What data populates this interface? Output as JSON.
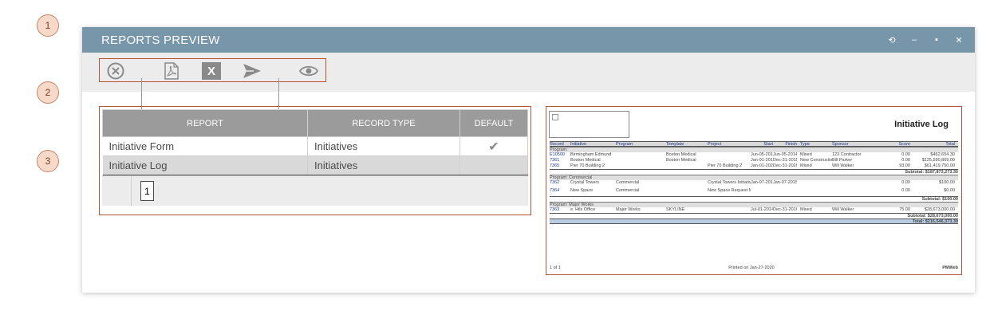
{
  "callouts": [
    "1",
    "2",
    "3"
  ],
  "window": {
    "title": "REPORTS PREVIEW",
    "controls": {
      "refresh": "⟲",
      "minimize": "–",
      "maximize": "▪",
      "close": "✕"
    }
  },
  "toolbar": {
    "icons": [
      "close-circle-icon",
      "pdf-icon",
      "excel-icon",
      "send-icon",
      "eye-icon"
    ],
    "excel_glyph": "X"
  },
  "reports_table": {
    "columns": [
      "REPORT",
      "RECORD TYPE",
      "DEFAULT"
    ],
    "rows": [
      {
        "report": "Initiative Form",
        "record_type": "Initiatives",
        "default": "✔"
      },
      {
        "report": "Initiative Log",
        "record_type": "Initiatives",
        "default": ""
      }
    ],
    "page": "1"
  },
  "preview": {
    "title": "Initiative Log",
    "columns": [
      "Record",
      "Initiative",
      "Program",
      "Template",
      "Project",
      "Start",
      "Finish",
      "Type",
      "Sponsor",
      "Score",
      "Total"
    ],
    "groups": [
      {
        "label": "Program:",
        "rows": [
          [
            "E10500",
            "Birmingham Edmund",
            "",
            "Boston Medical",
            "",
            "Jun-05-2014",
            "Jun-05-2014",
            "Mixed",
            "123 Contractor",
            "0.00",
            "$462,654.30"
          ],
          [
            "7361",
            "Boston Medical",
            "",
            "Boston Medical",
            "",
            "Jan-01-2015",
            "Dec-31-2015",
            "New Construction",
            "Bill Parker",
            "0.00",
            "$125,590,869.00"
          ],
          [
            "7365",
            "Pier 70 Building 2",
            "",
            "",
            "Pier 70 Building 2",
            "Jan-01-2020",
            "Dec-31-2020",
            "Mixed",
            "Will Walker",
            "93.00",
            "$61,419,750.00"
          ]
        ],
        "subtotal": "Subtotal:  $187,873,273.30"
      },
      {
        "label": "Program:  Commercial",
        "rows": [
          [
            "7362",
            "Crystal Towers",
            "Commercial",
            "",
            "Crystal Towers Initiative",
            "Jan-07-2015",
            "Jan-07-2015",
            "",
            "",
            "0.00",
            "$100.00"
          ],
          [
            "7364",
            "New Space",
            "Commercial",
            "",
            "New Space Request Initiative",
            "",
            "",
            "",
            "",
            "0.00",
            "$0.00"
          ]
        ],
        "subtotal": "Subtotal:  $100.00"
      },
      {
        "label": "Program:  Major Works",
        "rows": [
          [
            "7363",
            "e. Hils Office",
            "Major Works",
            "SKYLINE",
            "",
            "Jul-01-2014",
            "Dec-31-2016",
            "Mixed",
            "Will Walker",
            "75.00",
            "$28,673,000.00"
          ]
        ],
        "subtotal": "Subtotal:  $28,673,000.00"
      }
    ],
    "total": "Total:  $216,546,373.30",
    "footer": {
      "page": "1 of 1",
      "printed": "Printed on Jan-27-2020",
      "brand": "PMWeb"
    }
  }
}
